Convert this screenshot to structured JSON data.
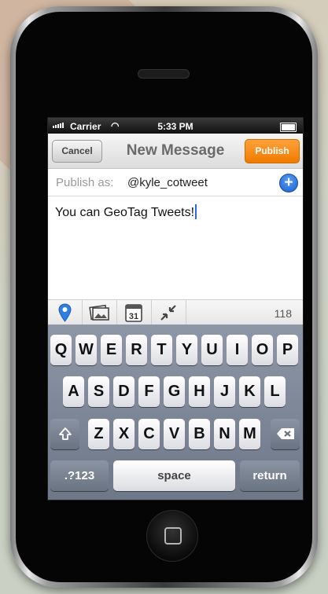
{
  "status_bar": {
    "carrier": "Carrier",
    "time": "5:33 PM"
  },
  "nav": {
    "cancel_label": "Cancel",
    "title": "New Message",
    "publish_label": "Publish"
  },
  "publish_as": {
    "label": "Publish as:",
    "account": "@kyle_cotweet",
    "add_label": "+"
  },
  "message": {
    "text": "You can GeoTag Tweets!"
  },
  "toolbar": {
    "icons": [
      "location-pin-icon",
      "photo-icon",
      "calendar-icon",
      "shrink-url-icon"
    ],
    "calendar_day": "31",
    "char_count": "118"
  },
  "keyboard": {
    "row1": [
      "Q",
      "W",
      "E",
      "R",
      "T",
      "Y",
      "U",
      "I",
      "O",
      "P"
    ],
    "row2": [
      "A",
      "S",
      "D",
      "F",
      "G",
      "H",
      "J",
      "K",
      "L"
    ],
    "row3": [
      "Z",
      "X",
      "C",
      "V",
      "B",
      "N",
      "M"
    ],
    "numbers_label": ".?123",
    "space_label": "space",
    "return_label": "return"
  },
  "colors": {
    "publish": "#f07a00",
    "add": "#1a5fcf",
    "keyboard_bg": "#7b8596"
  }
}
